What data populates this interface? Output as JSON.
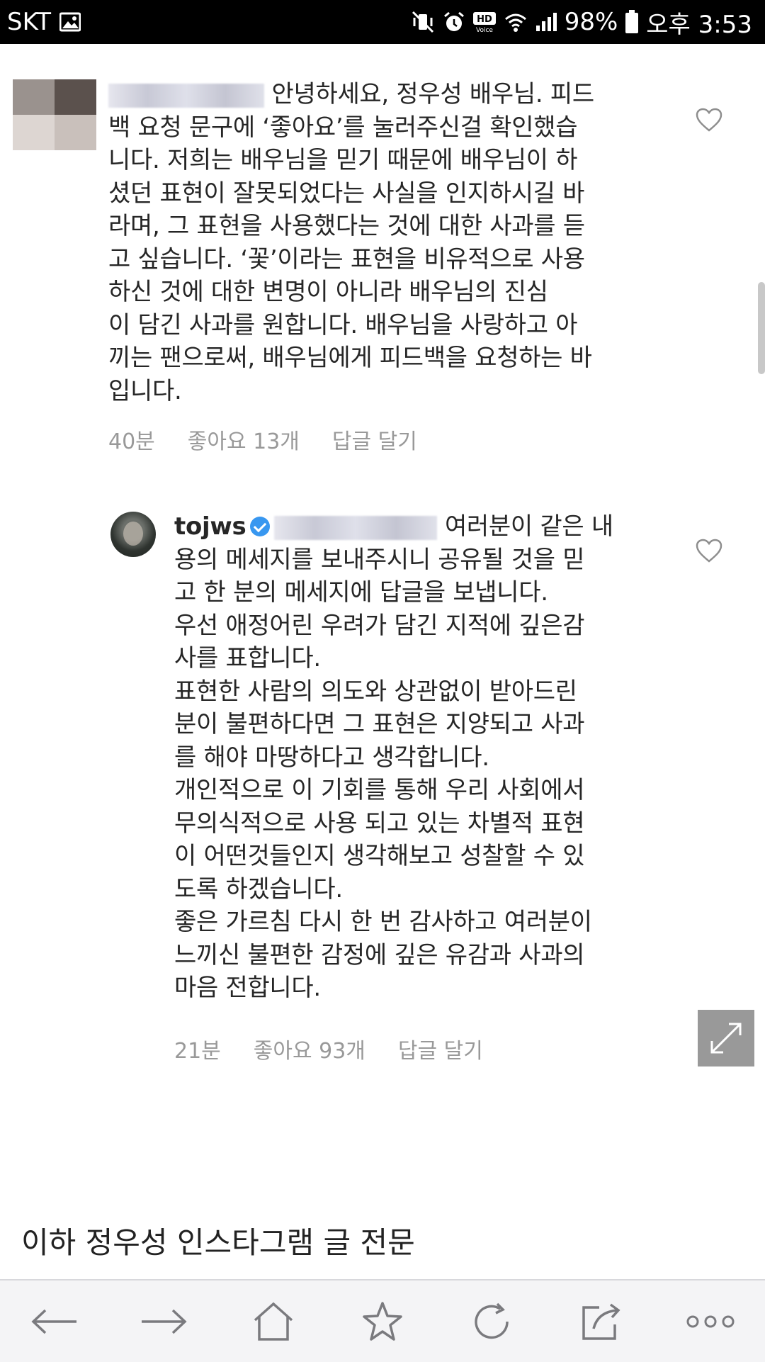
{
  "status_bar": {
    "carrier": "SKT",
    "battery_percent": "98%",
    "time": "오후 3:53",
    "icons": [
      "gallery-icon",
      "mute-vibrate-icon",
      "alarm-icon",
      "hd-voice-icon",
      "wifi-icon",
      "signal-icon",
      "battery-icon"
    ]
  },
  "comment1": {
    "lines": [
      "안녕하세요, 정우성 배우님. 피드",
      "백 요청 문구에 ‘좋아요’를 눌러주신걸 확인했습",
      "니다. 저희는 배우님을 믿기 때문에 배우님이 하",
      "셨던 표현이 잘못되었다는 사실을 인지하시길 바",
      "라며, 그 표현을 사용했다는 것에 대한 사과를 듣",
      "고 싶습니다. ‘꽃’이라는 표현을 비유적으로 사용",
      "하신 것에 대한 변명이 아니라 배우님의 진심",
      "이 담긴 사과를 원합니다. 배우님을 사랑하고 아",
      "끼는 팬으로써, 배우님에게 피드백을 요청하는 바",
      "입니다."
    ],
    "time": "40분",
    "likes": "좋아요 13개",
    "reply": "답글 달기"
  },
  "comment2": {
    "username": "tojws",
    "lines": [
      "여러분이 같은 내",
      "용의 메세지를 보내주시니 공유될 것을 믿",
      "고 한 분의 메세지에 답글을 보냅니다.",
      "우선 애정어린 우려가 담긴 지적에 깊은감",
      "사를 표합니다.",
      "표현한 사람의 의도와 상관없이 받아드린",
      "분이 불편하다면 그 표현은 지양되고 사과",
      "를 해야 마땅하다고 생각합니다.",
      "개인적으로 이 기회를 통해 우리 사회에서",
      "무의식적으로 사용 되고 있는 차별적 표현",
      "이 어떤것들인지 생각해보고 성찰할 수 있",
      "도록 하겠습니다.",
      "좋은 가르침 다시 한 번 감사하고 여러분이",
      "느끼신 불편한 감정에 깊은 유감과 사과의",
      "마음 전합니다."
    ],
    "time": "21분",
    "likes": "좋아요 93개",
    "reply": "답글 달기"
  },
  "section_title": "이하 정우성 인스타그램 글 전문",
  "toolbar": {
    "buttons": [
      "back-icon",
      "forward-icon",
      "home-icon",
      "bookmark-star-icon",
      "refresh-icon",
      "share-icon",
      "more-icon"
    ]
  }
}
